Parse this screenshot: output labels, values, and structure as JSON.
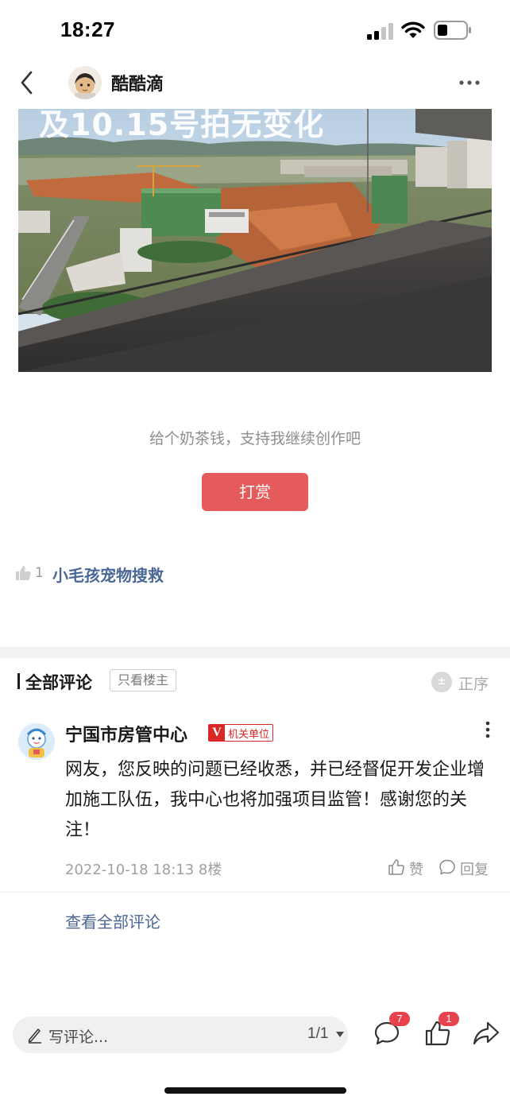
{
  "status_bar": {
    "time": "18:27"
  },
  "header": {
    "author_name": "酷酷滴"
  },
  "article": {
    "image_caption": "及10.15号拍无变化",
    "tip_text": "给个奶茶钱，支持我继续创作吧",
    "reward_label": "打赏",
    "like_count": "1",
    "liked_by": "小毛孩宠物搜救"
  },
  "comments_section": {
    "title": "全部评论",
    "author_only": "只看楼主",
    "sort_icon_text": "±",
    "sort_label": "正序",
    "view_all": "查看全部评论"
  },
  "comments": [
    {
      "name": "宁国市房管中心",
      "badge_v": "V",
      "badge_text": "机关单位",
      "text": "网友，您反映的问题已经收悉，并已经督促开发企业增加施工队伍，我中心也将加强项目监管！感谢您的关注！",
      "meta": "2022-10-18 18:13  8楼",
      "like_label": "赞",
      "reply_label": "回复"
    }
  ],
  "bottom_bar": {
    "placeholder": "写评论...",
    "page_indicator": "1/1",
    "comment_count": "7",
    "like_count": "1"
  },
  "colors": {
    "accent_red": "#e55a5a",
    "link_blue": "#4a6796",
    "badge_red": "#e8434d"
  },
  "icons": [
    "back-icon",
    "more-icon",
    "thumb-up-icon",
    "sort-icon",
    "pen-icon",
    "comment-icon",
    "like-icon",
    "share-icon"
  ]
}
